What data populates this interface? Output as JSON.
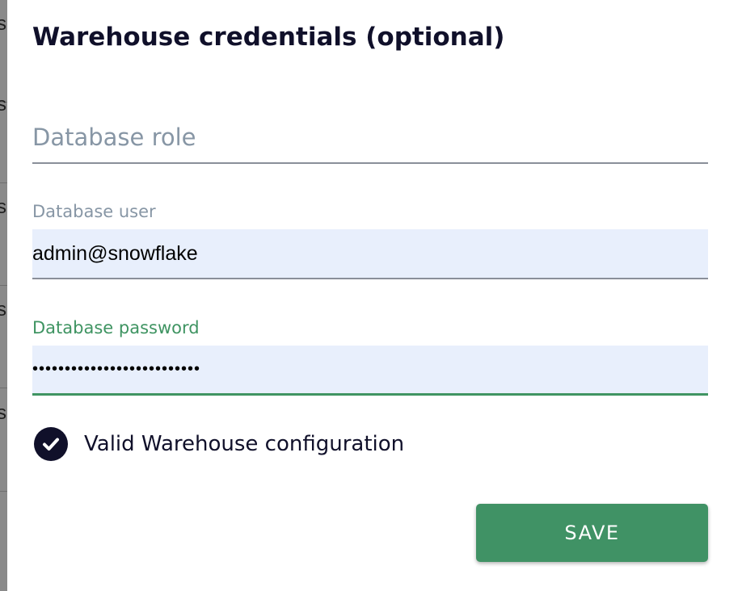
{
  "background_page": {
    "row_fragments": [
      "s",
      "s",
      "s",
      "s",
      "s"
    ]
  },
  "dialog": {
    "title": "Warehouse credentials (optional)",
    "fields": {
      "role": {
        "placeholder": "Database role",
        "value": ""
      },
      "user": {
        "label": "Database user",
        "value": "admin@snowflake"
      },
      "password": {
        "label": "Database password",
        "value": "••••••••••••••••••••••••••",
        "focused": true
      }
    },
    "status": {
      "icon": "check-circle-icon",
      "text": "Valid Warehouse configuration"
    },
    "save_label": "SAVE"
  },
  "colors": {
    "accent_green": "#409265",
    "label_focus_green": "#3f9462",
    "input_fill": "#e8effc",
    "text_dark": "#10102a",
    "label_gray": "#8796a5",
    "backdrop_gray": "#8a8a8a"
  }
}
